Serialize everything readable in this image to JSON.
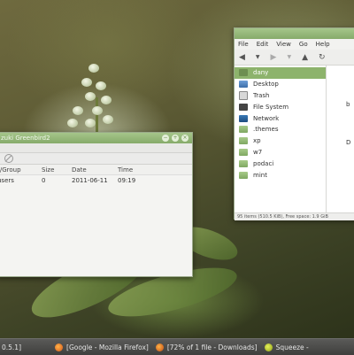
{
  "left_window": {
    "title": "zuki Greenbird2",
    "columns": [
      "r/Group",
      "Size",
      "Date",
      "Time"
    ],
    "rows": [
      {
        "name": "users",
        "size": "0",
        "date": "2011-06-11",
        "time": "09:19"
      }
    ]
  },
  "right_window": {
    "menu": [
      "File",
      "Edit",
      "View",
      "Go",
      "Help"
    ],
    "places": [
      {
        "label": "dany",
        "icon": "home-folder-icon",
        "selected": true
      },
      {
        "label": "Desktop",
        "icon": "desktop-icon",
        "selected": false
      },
      {
        "label": "Trash",
        "icon": "trash-icon",
        "selected": false
      },
      {
        "label": "File System",
        "icon": "filesystem-icon",
        "selected": false
      },
      {
        "label": "Network",
        "icon": "network-icon",
        "selected": false
      },
      {
        "label": ".themes",
        "icon": "folder-icon",
        "selected": false
      },
      {
        "label": "xp",
        "icon": "folder-icon",
        "selected": false
      },
      {
        "label": "w7",
        "icon": "folder-icon",
        "selected": false
      },
      {
        "label": "podaci",
        "icon": "folder-icon",
        "selected": false
      },
      {
        "label": "mint",
        "icon": "folder-icon",
        "selected": false
      }
    ],
    "main_fragments": [
      "b",
      "D"
    ],
    "status": "95 items (510.5 KiB), Free space: 1.9 GiB"
  },
  "taskbar": {
    "items": [
      {
        "label": "0.5.1]",
        "icon": ""
      },
      {
        "label": "[Google - Mozilla Firefox]",
        "icon": "firefox-icon"
      },
      {
        "label": "[72% of 1 file - Downloads]",
        "icon": "firefox-downloads-icon"
      },
      {
        "label": "Squeeze - ",
        "icon": "squeeze-icon"
      }
    ]
  },
  "colors": {
    "accent": "#8db36c",
    "titlebar": "#98ba7c",
    "taskbar": "#4a4a48"
  }
}
